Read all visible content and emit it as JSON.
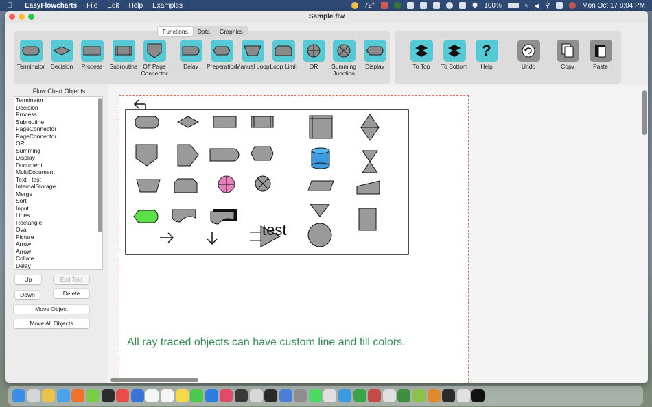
{
  "menubar": {
    "app_name": "EasyFlowcharts",
    "items": [
      "File",
      "Edit",
      "Help",
      "Examples"
    ],
    "temperature": "72°",
    "battery": "100%",
    "clock": "Mon Oct 17  8:04 PM"
  },
  "window": {
    "title": "Sample.flw"
  },
  "tabs": [
    {
      "label": "Functions",
      "active": true
    },
    {
      "label": "Data",
      "active": false
    },
    {
      "label": "Graphics",
      "active": false
    }
  ],
  "shape_tools": [
    {
      "label": "Terminator",
      "icon": "terminator-shape-icon"
    },
    {
      "label": "Decision",
      "icon": "decision-shape-icon"
    },
    {
      "label": "Process",
      "icon": "process-shape-icon"
    },
    {
      "label": "Subroutine",
      "icon": "subroutine-shape-icon"
    },
    {
      "label": "Off Page Connector",
      "icon": "off-page-connector-icon"
    },
    {
      "label": "Delay",
      "icon": "delay-shape-icon"
    },
    {
      "label": "Preperation",
      "icon": "preparation-shape-icon"
    },
    {
      "label": "Manual Loop",
      "icon": "manual-loop-icon"
    },
    {
      "label": "Loop Limit",
      "icon": "loop-limit-icon"
    },
    {
      "label": "OR",
      "icon": "or-shape-icon"
    },
    {
      "label": "Summing Junction",
      "icon": "summing-junction-icon"
    },
    {
      "label": "Display",
      "icon": "display-shape-icon"
    }
  ],
  "action_tools": [
    {
      "label": "To Top",
      "icon": "layers-up-icon"
    },
    {
      "label": "To Bottom",
      "icon": "layers-down-icon"
    },
    {
      "label": "Help",
      "icon": "question-icon"
    },
    {
      "label": "Undo",
      "icon": "undo-icon"
    },
    {
      "label": "Copy",
      "icon": "copy-icon"
    },
    {
      "label": "Paste",
      "icon": "paste-icon"
    }
  ],
  "sidebar": {
    "title": "Flow Chart Objects",
    "objects": [
      "Terminator",
      "Decision",
      "Process",
      "Subroutine",
      "PageConnector",
      "PageConnector",
      "OR",
      "Summing",
      "Display",
      "Document",
      "MultiDocument",
      "Text - test",
      "InternalStorage",
      "Merge",
      "Sort",
      "Input",
      "Lines",
      "Rectangle",
      "Oval",
      "Picture",
      "Arrow",
      "Arrow",
      "Collate",
      "Delay"
    ],
    "buttons": {
      "up": "Up",
      "edit_text": "Edit Text",
      "down": "Down",
      "delete": "Delete",
      "move_object": "Move Object",
      "move_all": "Move All Objects"
    }
  },
  "canvas": {
    "text_object": "test",
    "caption": "All ray traced objects can have custom line and fill colors.",
    "colors": {
      "shape_fill": "#9a9a9a",
      "highlight_fill": "#5be04a",
      "storage_fill": "#3a9be0",
      "or_fill": "#e06ab0",
      "caption": "#2f8f4f"
    }
  },
  "dock": {
    "apps": [
      "finder",
      "launchpad",
      "chrome",
      "safari",
      "firefox",
      "notes",
      "news",
      "messenger",
      "calendar",
      "notes-app",
      "reminders",
      "messages",
      "appstore",
      "music",
      "stocks",
      "calculator",
      "terminal",
      "r",
      "settings",
      "whatsapp",
      "videos",
      "xcode",
      "maps",
      "photos",
      "xbox",
      "clock",
      "terminal2",
      "graph",
      "preview",
      "home",
      "folder",
      "trash"
    ]
  }
}
